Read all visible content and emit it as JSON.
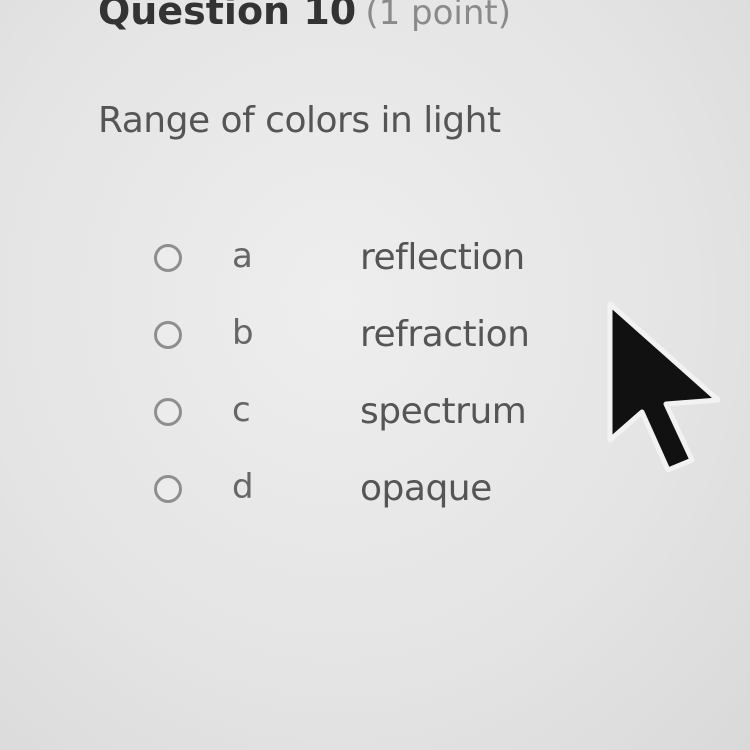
{
  "question": {
    "title": "Question 10",
    "points": "(1 point)",
    "prompt": "Range of colors in light"
  },
  "choices": [
    {
      "letter": "a",
      "text": "reflection"
    },
    {
      "letter": "b",
      "text": "refraction"
    },
    {
      "letter": "c",
      "text": "spectrum"
    },
    {
      "letter": "d",
      "text": "opaque"
    }
  ],
  "colors": {
    "background": "#e6e6e6",
    "title_text": "#333333",
    "points_text": "#8a8a8a",
    "body_text": "#555555",
    "radio_border": "#8e8e8e",
    "cursor": "#111111"
  },
  "icons": {
    "cursor": "arrow-cursor-icon",
    "radio": "radio-button-empty"
  }
}
